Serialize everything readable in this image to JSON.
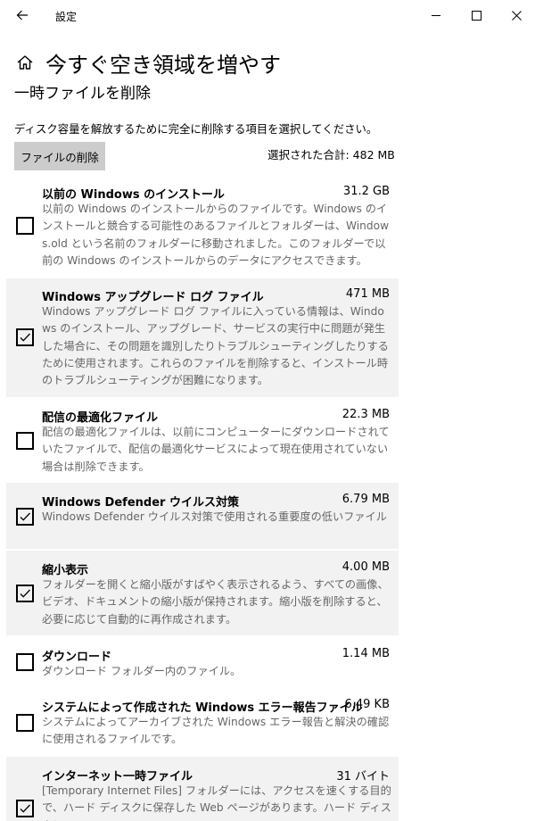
{
  "window": {
    "app_title": "設定"
  },
  "header": {
    "title": "今すぐ空き領域を増やす",
    "subtitle": "一時ファイルを削除",
    "description": "ディスク容量を解放するために完全に削除する項目を選択してください。",
    "delete_button": "ファイルの削除",
    "total_label": "選択された合計: 482 MB"
  },
  "items": [
    {
      "name": "以前の Windows のインストール",
      "size": "31.2 GB",
      "checked": false,
      "description": "以前の Windows のインストールからのファイルです。Windows のインストールと競合する可能性のあるファイルとフォルダーは、Windows.old という名前のフォルダーに移動されました。このフォルダーで以前の Windows のインストールからのデータにアクセスできます。"
    },
    {
      "name": "Windows アップグレード ログ ファイル",
      "size": "471 MB",
      "checked": true,
      "description": "Windows アップグレード ログ ファイルに入っている情報は、Windows のインストール、アップグレード、サービスの実行中に問題が発生した場合に、その問題を識別したりトラブルシューティングしたりするために使用されます。これらのファイルを削除すると、インストール時のトラブルシューティングが困難になります。"
    },
    {
      "name": "配信の最適化ファイル",
      "size": "22.3 MB",
      "checked": false,
      "description": "配信の最適化ファイルは、以前にコンピューターにダウンロードされていたファイルで、配信の最適化サービスによって現在使用されていない場合は削除できます。"
    },
    {
      "name": "Windows Defender ウイルス対策",
      "size": "6.79 MB",
      "checked": true,
      "description": "Windows Defender ウイルス対策で使用される重要度の低いファイル"
    },
    {
      "name": "縮小表示",
      "size": "4.00 MB",
      "checked": true,
      "description": "フォルダーを開くと縮小版がすばやく表示されるよう、すべての画像、ビデオ、ドキュメントの縮小版が保持されます。縮小版を削除すると、必要に応じて自動的に再作成されます。"
    },
    {
      "name": "ダウンロード",
      "size": "1.14 MB",
      "checked": false,
      "description": "ダウンロード フォルダー内のファイル。"
    },
    {
      "name": "システムによって作成された Windows エラー報告ファイル",
      "size": "6.49 KB",
      "checked": false,
      "description": "システムによってアーカイブされた Windows エラー報告と解決の確認に使用されるファイルです。"
    },
    {
      "name": "インターネット一時ファイル",
      "size": "31 バイト",
      "checked": true,
      "description": "[Temporary Internet Files] フォルダーには、アクセスを速くする目的で、ハード ディスクに保存した Web ページがあります。ハード ディスクに"
    }
  ]
}
